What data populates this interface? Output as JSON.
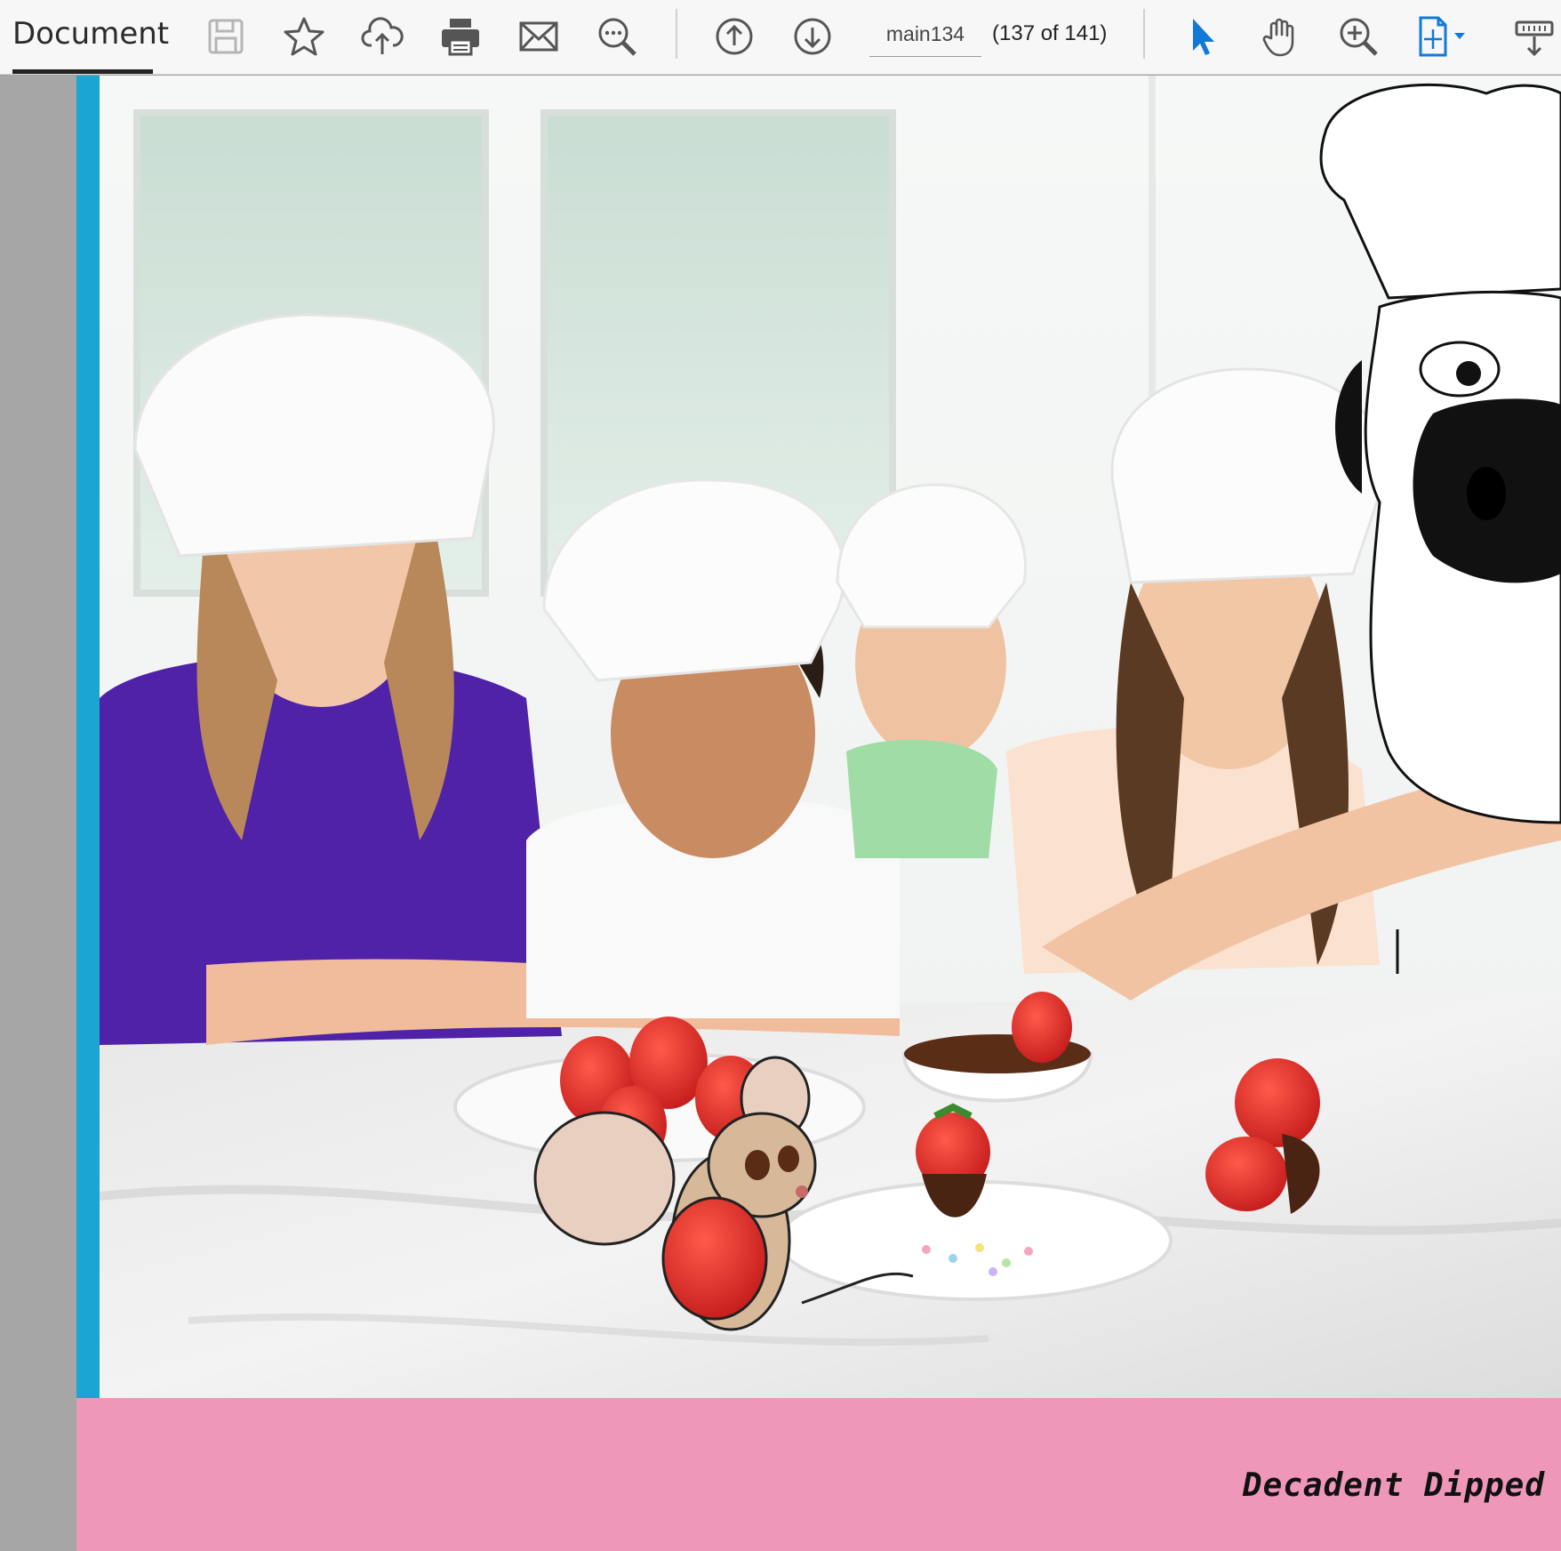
{
  "toolbar": {
    "tab_label": "Document",
    "page_field_value": "main134",
    "page_count": "(137 of 141)",
    "icons": [
      "save-icon",
      "bookmark-star-icon",
      "upload-cloud-icon",
      "print-icon",
      "email-icon",
      "find-icon",
      "prev-page-icon",
      "next-page-icon",
      "select-pointer-icon",
      "hand-tool-icon",
      "zoom-in-icon",
      "fit-page-icon",
      "page-display-icon"
    ]
  },
  "document": {
    "caption": "Decadent Dipped"
  },
  "colors": {
    "accent_blue": "#1279d6",
    "blue_strip": "#1aa5d3",
    "pink_band": "#ee97b8"
  }
}
